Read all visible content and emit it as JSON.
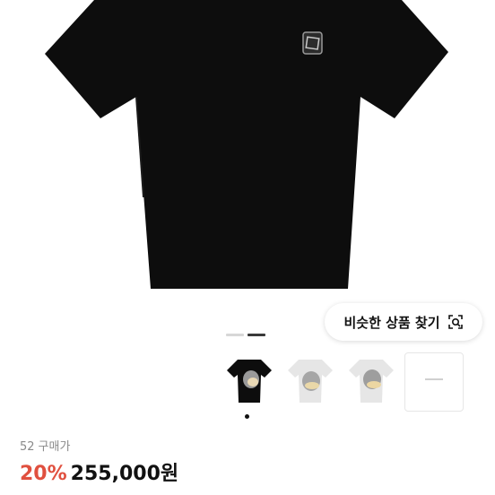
{
  "product": {
    "image_icon": "black-tshirt-image",
    "gallery_indicator": {
      "count": 2,
      "active": 1
    }
  },
  "similar_button": {
    "label": "비슷한 상품 찾기",
    "icon": "visual-search-icon"
  },
  "thumbnails": [
    {
      "name": "black-tshirt-thumb",
      "selected": true
    },
    {
      "name": "white-tshirt-thumb",
      "selected": false
    },
    {
      "name": "white-tshirt-thumb-2",
      "selected": false
    },
    {
      "name": "box-thumb",
      "selected": false
    }
  ],
  "stats": {
    "count": "52",
    "label": "구매가"
  },
  "price": {
    "discount": "20%",
    "amount": "255,000원"
  },
  "colors": {
    "discount": "#e0503f",
    "shirt": "#0d0d0d"
  }
}
